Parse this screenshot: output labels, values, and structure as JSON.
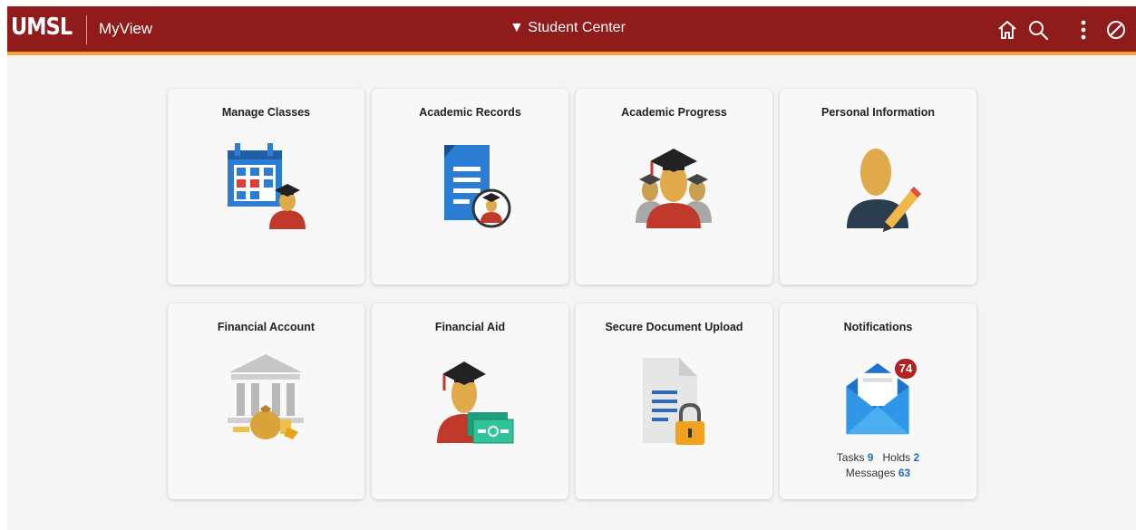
{
  "header": {
    "logo": "UMSL",
    "app_name": "MyView",
    "title": "▼ Student Center",
    "icons": [
      "home-icon",
      "search-icon",
      "more-options-icon",
      "navbar-compass-icon"
    ],
    "bg_color": "#8f1b1b",
    "accent_color": "#f2a33a"
  },
  "tiles": [
    {
      "title": "Manage Classes",
      "icon": "calendar-student-icon"
    },
    {
      "title": "Academic Records",
      "icon": "document-graduate-icon"
    },
    {
      "title": "Academic Progress",
      "icon": "graduates-group-icon"
    },
    {
      "title": "Personal Information",
      "icon": "person-pencil-icon"
    },
    {
      "title": "Financial Account",
      "icon": "bank-moneybag-icon"
    },
    {
      "title": "Financial Aid",
      "icon": "graduate-money-icon"
    },
    {
      "title": "Secure Document Upload",
      "icon": "document-lock-icon"
    },
    {
      "title": "Notifications",
      "icon": "envelope-icon",
      "badge": "74",
      "tasks_label": "Tasks",
      "tasks_count": "9",
      "holds_label": "Holds",
      "holds_count": "2",
      "messages_label": "Messages",
      "messages_count": "63"
    }
  ]
}
